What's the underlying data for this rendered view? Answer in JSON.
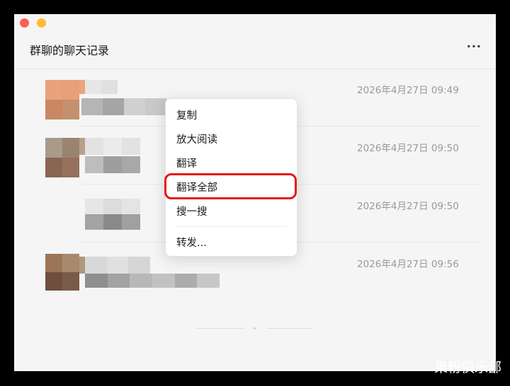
{
  "window": {
    "title": "群聊的聊天记录",
    "more_label": "···"
  },
  "messages": [
    {
      "time": "2026年4月27日 09:49"
    },
    {
      "time": "2026年4月27日 09:50"
    },
    {
      "time": "2026年4月27日 09:50"
    },
    {
      "time": "2026年4月27日 09:56"
    }
  ],
  "context_menu": {
    "items": [
      {
        "label": "复制"
      },
      {
        "label": "放大阅读"
      },
      {
        "label": "翻译"
      },
      {
        "label": "翻译全部"
      },
      {
        "label": "搜一搜"
      },
      {
        "label": "转发..."
      }
    ],
    "highlighted": "翻译全部",
    "highlight_color": "#e8141a"
  },
  "watermark": "果粉俱乐部"
}
